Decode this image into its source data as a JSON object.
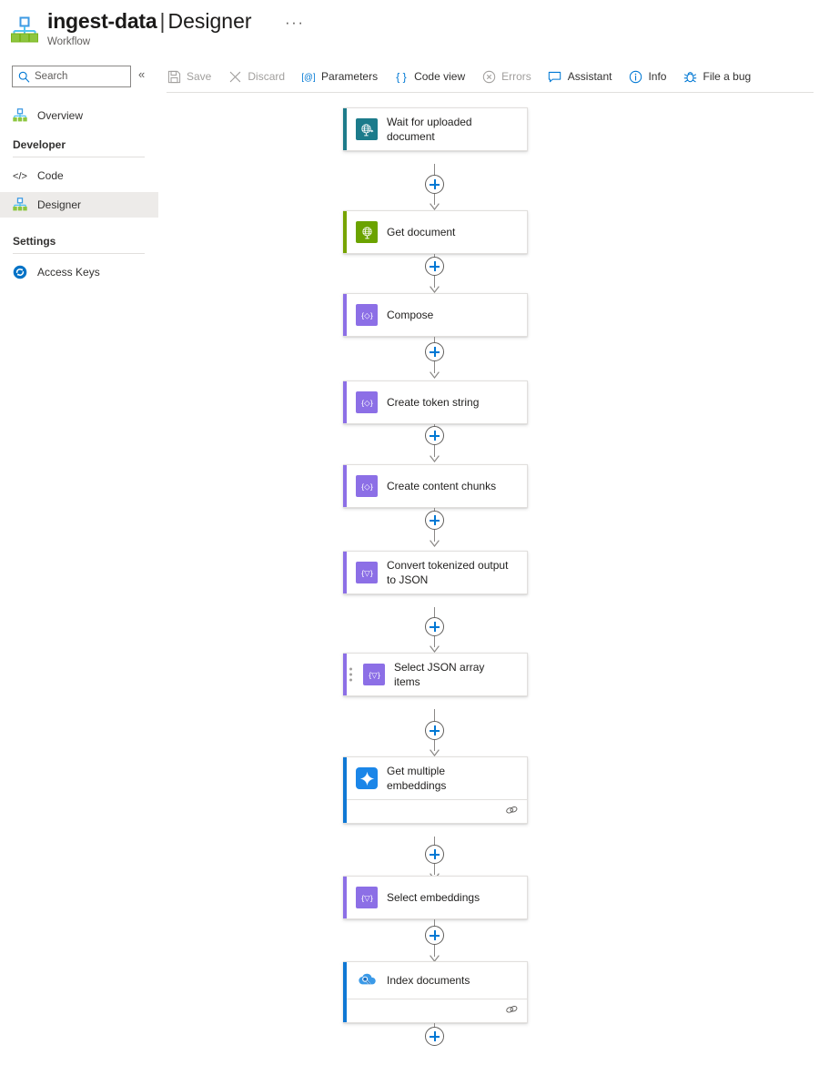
{
  "header": {
    "app_icon": "logic-app-icon",
    "workflow_name": "ingest-data",
    "separator": "|",
    "page_name": "Designer",
    "ellipsis": "···",
    "subtitle": "Workflow"
  },
  "sidebar": {
    "search": {
      "placeholder": "Search",
      "value": "",
      "icon": "search-icon"
    },
    "collapse": {
      "label": "«",
      "icon": "chevron-double-left-icon"
    },
    "items": [
      {
        "label": "Overview",
        "icon": "logic-app-icon",
        "selected": false
      },
      {
        "label": "Code",
        "icon": "code-icon",
        "selected": false
      },
      {
        "label": "Designer",
        "icon": "logic-app-icon",
        "selected": true
      },
      {
        "label": "Access Keys",
        "icon": "access-keys-icon",
        "selected": false
      }
    ],
    "groups": [
      {
        "label": "Developer"
      },
      {
        "label": "Settings"
      }
    ]
  },
  "toolbar": {
    "buttons": [
      {
        "label": "Save",
        "icon": "save-icon",
        "disabled": true
      },
      {
        "label": "Discard",
        "icon": "discard-icon",
        "disabled": true
      },
      {
        "label": "Parameters",
        "icon": "parameters-icon",
        "disabled": false
      },
      {
        "label": "Code view",
        "icon": "code-view-icon",
        "disabled": false
      },
      {
        "label": "Errors",
        "icon": "errors-icon",
        "disabled": true
      },
      {
        "label": "Assistant",
        "icon": "assistant-icon",
        "disabled": false
      },
      {
        "label": "Info",
        "icon": "info-icon",
        "disabled": false
      },
      {
        "label": "File a bug",
        "icon": "bug-icon",
        "disabled": false
      }
    ]
  },
  "colors": {
    "accent_teal": "#1d7b8a",
    "accent_green": "#77a300",
    "accent_purple": "#8c6fe6",
    "accent_blue": "#0f78d4",
    "plus_blue": "#0078d4",
    "connector_gray": "#8a8886"
  },
  "canvas": {
    "nodes": [
      {
        "title": "Wait for uploaded document",
        "icon": "blob-trigger-icon",
        "accent": "#1d7b8a",
        "icon_bg": "#1c7b8b",
        "two_line": true,
        "footer": false,
        "drag_handle": false
      },
      {
        "title": "Get document",
        "icon": "blob-action-icon",
        "accent": "#77a300",
        "icon_bg": "#6ba300",
        "two_line": false,
        "footer": false,
        "drag_handle": false
      },
      {
        "title": "Compose",
        "icon": "compose-icon",
        "accent": "#8c6fe6",
        "icon_bg": "#8c6fe6",
        "two_line": false,
        "footer": false,
        "drag_handle": false
      },
      {
        "title": "Create token string",
        "icon": "compose-icon",
        "accent": "#8c6fe6",
        "icon_bg": "#8c6fe6",
        "two_line": false,
        "footer": false,
        "drag_handle": false
      },
      {
        "title": "Create content chunks",
        "icon": "compose-icon",
        "accent": "#8c6fe6",
        "icon_bg": "#8c6fe6",
        "two_line": false,
        "footer": false,
        "drag_handle": false
      },
      {
        "title": "Convert tokenized output to JSON",
        "icon": "compose-icon",
        "accent": "#8c6fe6",
        "icon_bg": "#8c6fe6",
        "two_line": true,
        "footer": false,
        "drag_handle": false
      },
      {
        "title": "Select JSON array items",
        "icon": "select-icon",
        "accent": "#8c6fe6",
        "icon_bg": "#8c6fe6",
        "two_line": true,
        "footer": false,
        "drag_handle": true
      },
      {
        "title": "Get multiple embeddings",
        "icon": "azure-openai-icon",
        "accent": "#0f78d4",
        "icon_bg": "#0f78d4",
        "two_line": true,
        "footer": true,
        "drag_handle": false
      },
      {
        "title": "Select embeddings",
        "icon": "select-icon",
        "accent": "#8c6fe6",
        "icon_bg": "#8c6fe6",
        "two_line": false,
        "footer": false,
        "drag_handle": false
      },
      {
        "title": "Index documents",
        "icon": "azure-search-icon",
        "accent": "#0f78d4",
        "icon_bg": "transparent",
        "two_line": false,
        "footer": true,
        "drag_handle": false
      }
    ],
    "footer_icon": "connection-link-icon",
    "add_button_icon": "plus-icon"
  }
}
